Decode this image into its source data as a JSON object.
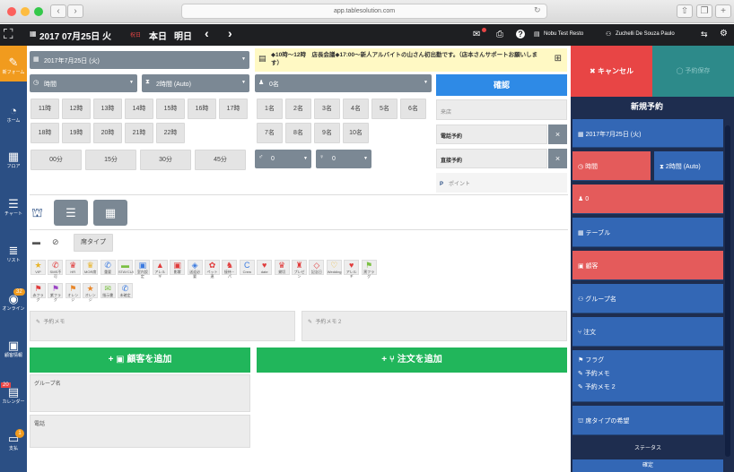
{
  "browser": {
    "url": "app.tablesolution.com"
  },
  "topbar": {
    "date": "2017 07月25日 火",
    "weekday_note": "祝日",
    "today_button": "本日",
    "tomorrow_button": "明日",
    "store": "Nobu Test Resto",
    "user": "Zuchelli De Souza Paulo"
  },
  "sidebar": {
    "items": [
      {
        "label": "新フォーム",
        "icon": "edit-icon"
      },
      {
        "label": "ホーム",
        "icon": "dashboard-icon"
      },
      {
        "label": "フロア",
        "icon": "floor-icon"
      },
      {
        "label": "チャート",
        "icon": "chart-icon"
      },
      {
        "label": "リスト",
        "icon": "list-icon"
      },
      {
        "label": "オンライン",
        "icon": "online-icon",
        "badge": "32"
      },
      {
        "label": "顧客情報",
        "icon": "customer-icon"
      },
      {
        "label": "カレンダー",
        "icon": "calendar-icon",
        "badge": "20"
      },
      {
        "label": "支払",
        "icon": "pay-icon",
        "badge": "1"
      }
    ]
  },
  "form": {
    "date_select": "2017年7月25日 (火)",
    "time_select": "時間",
    "duration_select": "2時間 (Auto)",
    "people_select": "0名",
    "notice": "◆10時～12時　店長会議◆17:00～新人アルバイトの山さん初出勤です。（店本さんサポートお願いします）",
    "confirm_button": "確認",
    "hours": [
      "11時",
      "12時",
      "13時",
      "14時",
      "15時",
      "16時",
      "17時",
      "18時",
      "19時",
      "20時",
      "21時",
      "22時"
    ],
    "minutes": [
      "00分",
      "15分",
      "30分",
      "45分"
    ],
    "people": [
      "1名",
      "2名",
      "3名",
      "4名",
      "5名",
      "6名",
      "7名",
      "8名",
      "9名",
      "10名"
    ],
    "male_count": "0",
    "female_count": "0",
    "memo_placeholder": "予約メモ",
    "memo2_placeholder": "予約メモ 2",
    "seat_type": "席タイプ",
    "phone_reservation": "電話予約",
    "direct_reservation": "直接予約",
    "note_placeholder": "来店",
    "points_placeholder": "ポイント",
    "add_customer": "顧客を追加",
    "add_order": "注文を追加",
    "group_name_label": "グループ名",
    "phone_label": "電話"
  },
  "tags_row1": [
    {
      "name": "VIP",
      "icon": "★",
      "color": "#e8b42a"
    },
    {
      "name": "SMS不可",
      "icon": "✆",
      "color": "#e03c3c"
    },
    {
      "name": "HR",
      "icon": "♛",
      "color": "#e03c3c"
    },
    {
      "name": "MOR席",
      "icon": "♛",
      "color": "#e8b42a"
    },
    {
      "name": "重要",
      "icon": "✆",
      "color": "#3c7be0"
    },
    {
      "name": "STAYCUI",
      "icon": "▬",
      "color": "#7bc043"
    },
    {
      "name": "室内設定",
      "icon": "▣",
      "color": "#3c7be0"
    },
    {
      "name": "アレルギ",
      "icon": "▲",
      "color": "#e03c3c"
    },
    {
      "name": "影響",
      "icon": "▣",
      "color": "#e03c3c"
    },
    {
      "name": "送迎必要",
      "icon": "◈",
      "color": "#3c7be0"
    },
    {
      "name": "ペット連",
      "icon": "✿",
      "color": "#e03c3c"
    },
    {
      "name": "接待・パ",
      "icon": "♞",
      "color": "#e03c3c"
    },
    {
      "name": "Crew",
      "icon": "C",
      "color": "#3c7be0"
    },
    {
      "name": "date",
      "icon": "♥",
      "color": "#e03c3c"
    },
    {
      "name": "貸切",
      "icon": "♛",
      "color": "#e03c3c"
    },
    {
      "name": "プレゼン",
      "icon": "♜",
      "color": "#e03c3c"
    },
    {
      "name": "記念日",
      "icon": "◇",
      "color": "#e03c3c"
    },
    {
      "name": "Wedding",
      "icon": "♡",
      "color": "#e8b42a"
    },
    {
      "name": "アレルギ",
      "icon": "♥",
      "color": "#e03c3c"
    },
    {
      "name": "黒フラグ",
      "icon": "⚑",
      "color": "#7bc043"
    }
  ],
  "tags_row2": [
    {
      "name": "赤フラグ",
      "icon": "⚑",
      "color": "#e03c3c"
    },
    {
      "name": "紫フラグ",
      "icon": "⚑",
      "color": "#9b44c4"
    },
    {
      "name": "オレンジ",
      "icon": "⚑",
      "color": "#e8872a"
    },
    {
      "name": "オレンジ",
      "icon": "★",
      "color": "#e8872a"
    },
    {
      "name": "指示書",
      "icon": "✉",
      "color": "#7bc043"
    },
    {
      "name": "未確定",
      "icon": "✆",
      "color": "#3c7be0"
    }
  ],
  "right_panel": {
    "cancel": "キャンセル",
    "pending": "予約保存",
    "title": "新規予約",
    "date": "2017年7月25日 (火)",
    "time": "時間",
    "duration": "2時間 (Auto)",
    "people": "0",
    "table": "テーブル",
    "menu": "顧客",
    "group": "グループ名",
    "order": "注文",
    "flag": "フラグ",
    "memo": "予約メモ",
    "memo2": "予約メモ 2",
    "seat_pref": "席タイプの希望",
    "status": "ステータス",
    "status_value": "確定"
  }
}
